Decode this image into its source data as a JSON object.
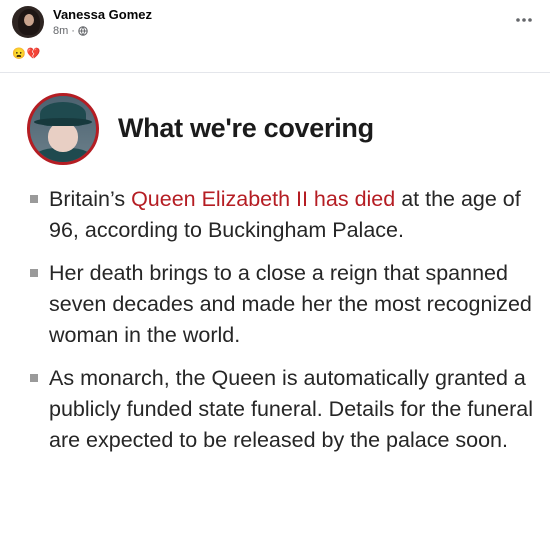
{
  "post": {
    "author": "Vanessa Gomez",
    "time": "8m",
    "separator": "·",
    "reaction": "😦💔"
  },
  "card": {
    "heading": "What we're covering",
    "bullets": [
      {
        "before": "Britain’s ",
        "link": "Queen Elizabeth II has died",
        "after": " at the age of 96, according to Buckingham Palace."
      },
      {
        "text": "Her death brings to a close a reign that spanned seven decades and made her the most recognized woman in the world."
      },
      {
        "text": "As monarch, the Queen is automatically granted a publicly funded state funeral. Details for the funeral are expected to be released by the palace soon."
      }
    ]
  },
  "colors": {
    "accent": "#b51d23",
    "meta_text": "#65676b",
    "divider": "#e4e6eb"
  },
  "icons": [
    "more-options-icon",
    "globe-icon",
    "bullet-square-icon"
  ]
}
